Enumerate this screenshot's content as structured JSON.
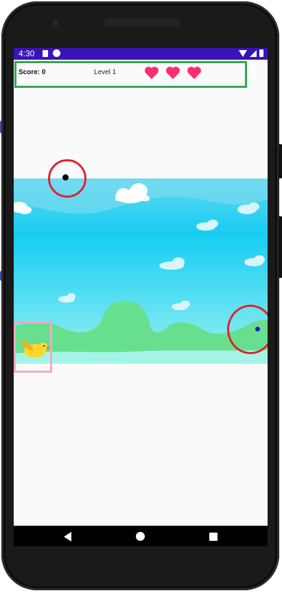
{
  "status_bar": {
    "time": "4:30",
    "icons": [
      "sd-card-icon",
      "app-notification-icon",
      "wifi-icon",
      "signal-icon",
      "battery-icon"
    ]
  },
  "hud": {
    "score_text": "Score: 0",
    "level_text": "Level 1",
    "lives": 3,
    "heart_color": "#ff2d6f",
    "border_color": "#2ea84f"
  },
  "scene": {
    "sky_colors": [
      "#63d7f0",
      "#17cdf2",
      "#9af2f0"
    ],
    "hill_color": "#68df8e",
    "obstacle_ring_color": "#e0202d",
    "bird_box_color": "#f3a9c6",
    "bird_color": "#ffd62e"
  },
  "nav_bar": {
    "buttons": [
      "back-icon",
      "home-icon",
      "recent-apps-icon"
    ]
  },
  "colors": {
    "status_bar": "#3a14b8",
    "screen_bg": "#fafafa",
    "frame": "#1a1a1a"
  }
}
